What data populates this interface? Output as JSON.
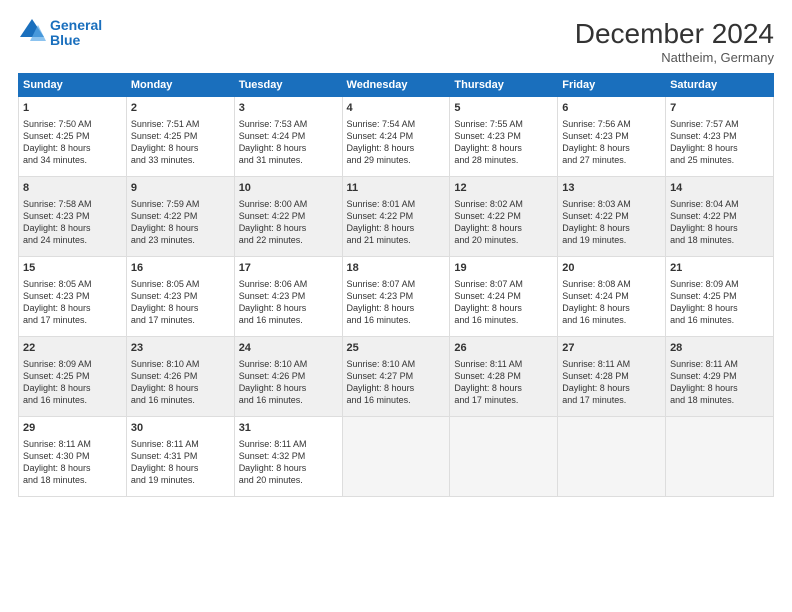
{
  "header": {
    "logo_line1": "General",
    "logo_line2": "Blue",
    "month_title": "December 2024",
    "location": "Nattheim, Germany"
  },
  "weekdays": [
    "Sunday",
    "Monday",
    "Tuesday",
    "Wednesday",
    "Thursday",
    "Friday",
    "Saturday"
  ],
  "weeks": [
    [
      {
        "day": "1",
        "lines": [
          "Sunrise: 7:50 AM",
          "Sunset: 4:25 PM",
          "Daylight: 8 hours",
          "and 34 minutes."
        ]
      },
      {
        "day": "2",
        "lines": [
          "Sunrise: 7:51 AM",
          "Sunset: 4:25 PM",
          "Daylight: 8 hours",
          "and 33 minutes."
        ]
      },
      {
        "day": "3",
        "lines": [
          "Sunrise: 7:53 AM",
          "Sunset: 4:24 PM",
          "Daylight: 8 hours",
          "and 31 minutes."
        ]
      },
      {
        "day": "4",
        "lines": [
          "Sunrise: 7:54 AM",
          "Sunset: 4:24 PM",
          "Daylight: 8 hours",
          "and 29 minutes."
        ]
      },
      {
        "day": "5",
        "lines": [
          "Sunrise: 7:55 AM",
          "Sunset: 4:23 PM",
          "Daylight: 8 hours",
          "and 28 minutes."
        ]
      },
      {
        "day": "6",
        "lines": [
          "Sunrise: 7:56 AM",
          "Sunset: 4:23 PM",
          "Daylight: 8 hours",
          "and 27 minutes."
        ]
      },
      {
        "day": "7",
        "lines": [
          "Sunrise: 7:57 AM",
          "Sunset: 4:23 PM",
          "Daylight: 8 hours",
          "and 25 minutes."
        ]
      }
    ],
    [
      {
        "day": "8",
        "lines": [
          "Sunrise: 7:58 AM",
          "Sunset: 4:23 PM",
          "Daylight: 8 hours",
          "and 24 minutes."
        ]
      },
      {
        "day": "9",
        "lines": [
          "Sunrise: 7:59 AM",
          "Sunset: 4:22 PM",
          "Daylight: 8 hours",
          "and 23 minutes."
        ]
      },
      {
        "day": "10",
        "lines": [
          "Sunrise: 8:00 AM",
          "Sunset: 4:22 PM",
          "Daylight: 8 hours",
          "and 22 minutes."
        ]
      },
      {
        "day": "11",
        "lines": [
          "Sunrise: 8:01 AM",
          "Sunset: 4:22 PM",
          "Daylight: 8 hours",
          "and 21 minutes."
        ]
      },
      {
        "day": "12",
        "lines": [
          "Sunrise: 8:02 AM",
          "Sunset: 4:22 PM",
          "Daylight: 8 hours",
          "and 20 minutes."
        ]
      },
      {
        "day": "13",
        "lines": [
          "Sunrise: 8:03 AM",
          "Sunset: 4:22 PM",
          "Daylight: 8 hours",
          "and 19 minutes."
        ]
      },
      {
        "day": "14",
        "lines": [
          "Sunrise: 8:04 AM",
          "Sunset: 4:22 PM",
          "Daylight: 8 hours",
          "and 18 minutes."
        ]
      }
    ],
    [
      {
        "day": "15",
        "lines": [
          "Sunrise: 8:05 AM",
          "Sunset: 4:23 PM",
          "Daylight: 8 hours",
          "and 17 minutes."
        ]
      },
      {
        "day": "16",
        "lines": [
          "Sunrise: 8:05 AM",
          "Sunset: 4:23 PM",
          "Daylight: 8 hours",
          "and 17 minutes."
        ]
      },
      {
        "day": "17",
        "lines": [
          "Sunrise: 8:06 AM",
          "Sunset: 4:23 PM",
          "Daylight: 8 hours",
          "and 16 minutes."
        ]
      },
      {
        "day": "18",
        "lines": [
          "Sunrise: 8:07 AM",
          "Sunset: 4:23 PM",
          "Daylight: 8 hours",
          "and 16 minutes."
        ]
      },
      {
        "day": "19",
        "lines": [
          "Sunrise: 8:07 AM",
          "Sunset: 4:24 PM",
          "Daylight: 8 hours",
          "and 16 minutes."
        ]
      },
      {
        "day": "20",
        "lines": [
          "Sunrise: 8:08 AM",
          "Sunset: 4:24 PM",
          "Daylight: 8 hours",
          "and 16 minutes."
        ]
      },
      {
        "day": "21",
        "lines": [
          "Sunrise: 8:09 AM",
          "Sunset: 4:25 PM",
          "Daylight: 8 hours",
          "and 16 minutes."
        ]
      }
    ],
    [
      {
        "day": "22",
        "lines": [
          "Sunrise: 8:09 AM",
          "Sunset: 4:25 PM",
          "Daylight: 8 hours",
          "and 16 minutes."
        ]
      },
      {
        "day": "23",
        "lines": [
          "Sunrise: 8:10 AM",
          "Sunset: 4:26 PM",
          "Daylight: 8 hours",
          "and 16 minutes."
        ]
      },
      {
        "day": "24",
        "lines": [
          "Sunrise: 8:10 AM",
          "Sunset: 4:26 PM",
          "Daylight: 8 hours",
          "and 16 minutes."
        ]
      },
      {
        "day": "25",
        "lines": [
          "Sunrise: 8:10 AM",
          "Sunset: 4:27 PM",
          "Daylight: 8 hours",
          "and 16 minutes."
        ]
      },
      {
        "day": "26",
        "lines": [
          "Sunrise: 8:11 AM",
          "Sunset: 4:28 PM",
          "Daylight: 8 hours",
          "and 17 minutes."
        ]
      },
      {
        "day": "27",
        "lines": [
          "Sunrise: 8:11 AM",
          "Sunset: 4:28 PM",
          "Daylight: 8 hours",
          "and 17 minutes."
        ]
      },
      {
        "day": "28",
        "lines": [
          "Sunrise: 8:11 AM",
          "Sunset: 4:29 PM",
          "Daylight: 8 hours",
          "and 18 minutes."
        ]
      }
    ],
    [
      {
        "day": "29",
        "lines": [
          "Sunrise: 8:11 AM",
          "Sunset: 4:30 PM",
          "Daylight: 8 hours",
          "and 18 minutes."
        ]
      },
      {
        "day": "30",
        "lines": [
          "Sunrise: 8:11 AM",
          "Sunset: 4:31 PM",
          "Daylight: 8 hours",
          "and 19 minutes."
        ]
      },
      {
        "day": "31",
        "lines": [
          "Sunrise: 8:11 AM",
          "Sunset: 4:32 PM",
          "Daylight: 8 hours",
          "and 20 minutes."
        ]
      },
      null,
      null,
      null,
      null
    ]
  ]
}
